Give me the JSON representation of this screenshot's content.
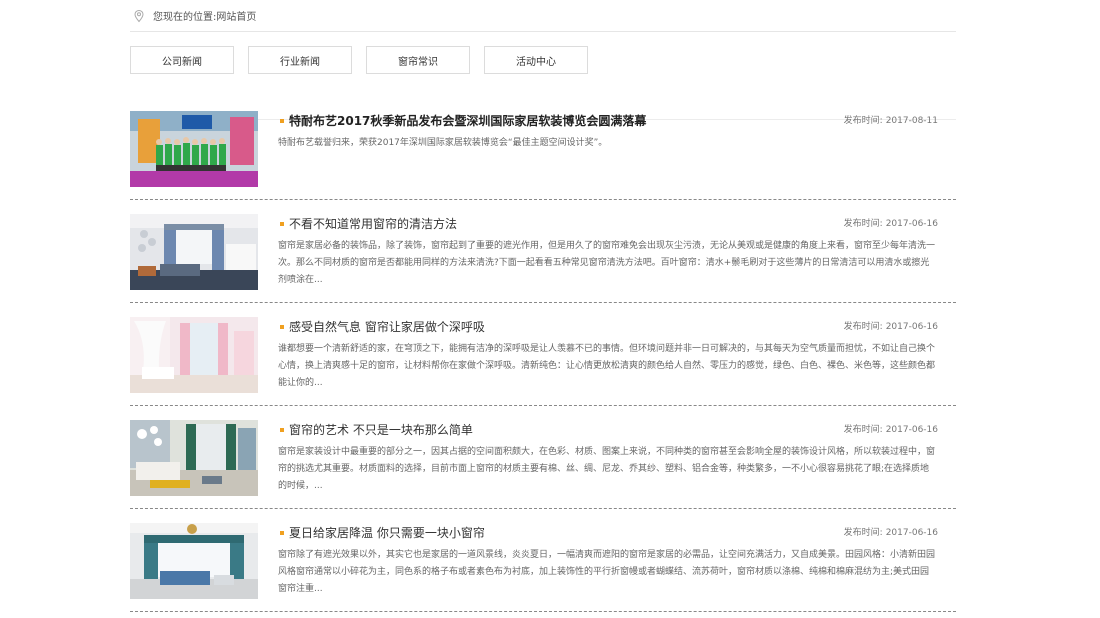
{
  "breadcrumb": {
    "label": "您现在的位置:",
    "home": "网站首页"
  },
  "tabs": [
    {
      "label": "公司新闻"
    },
    {
      "label": "行业新闻"
    },
    {
      "label": "窗帘常识"
    },
    {
      "label": "活动中心"
    }
  ],
  "date_label": "发布时间:",
  "articles": [
    {
      "title": "特耐布艺2017秋季新品发布会暨深圳国际家居软装博览会圆满落幕",
      "date": "2017-08-11",
      "summary": "特耐布艺载誉归来，荣获2017年深圳国际家居软装博览会“最佳主题空间设计奖”。"
    },
    {
      "title": "不看不知道常用窗帘的清洁方法",
      "date": "2017-06-16",
      "summary": "窗帘是家居必备的装饰品，除了装饰，窗帘起到了重要的遮光作用，但是用久了的窗帘难免会出现灰尘污渍，无论从美观或是健康的角度上来看，窗帘至少每年清洗一次。那么不同材质的窗帘是否都能用同样的方法来清洗?下面一起看看五种常见窗帘清洗方法吧。百叶窗帘：清水+鬃毛刷对于这些薄片的日常清洁可以用清水或擦光剂喷涂在..."
    },
    {
      "title": "感受自然气息 窗帘让家居做个深呼吸",
      "date": "2017-06-16",
      "summary": "谁都想要一个清新舒适的家，在穹顶之下，能拥有洁净的深呼吸是让人羡慕不已的事情。但环境问题并非一日可解决的，与其每天为空气质量而担忧，不如让自己换个心情，换上清爽感十足的窗帘，让材料帮你在家做个深呼吸。清新纯色：让心情更放松清爽的颜色给人自然、零压力的感觉，绿色、白色、裸色、米色等，这些颜色都能让你的..."
    },
    {
      "title": "窗帘的艺术 不只是一块布那么简单",
      "date": "2017-06-16",
      "summary": "窗帘是家装设计中最重要的部分之一，因其占据的空间面积颇大，在色彩、材质、图案上来说，不同种类的窗帘甚至会影响全屋的装饰设计风格，所以软装过程中，窗帘的挑选尤其重要。材质面料的选择，目前市面上窗帘的材质主要有棉、丝、绸、尼龙、乔其纱、塑料、铝合金等，种类繁多，一不小心很容易挑花了眼;在选择质地的时候，..."
    },
    {
      "title": "夏日给家居降温 你只需要一块小窗帘",
      "date": "2017-06-16",
      "summary": "窗帘除了有遮光效果以外，其实它也是家居的一道风景线，炎炎夏日，一幅清爽而遮阳的窗帘是家居的必需品，让空间充满活力，又自成美景。田园风格：小清新田园风格窗帘通常以小碎花为主，同色系的格子布或者素色布为衬底，加上装饰性的平行折窗幔或者蝴蝶结、流苏荷叶，窗帘材质以涤棉、纯棉和棉麻混纺为主;美式田园窗帘注重..."
    }
  ],
  "colors": {
    "accent": "#f0a020"
  }
}
